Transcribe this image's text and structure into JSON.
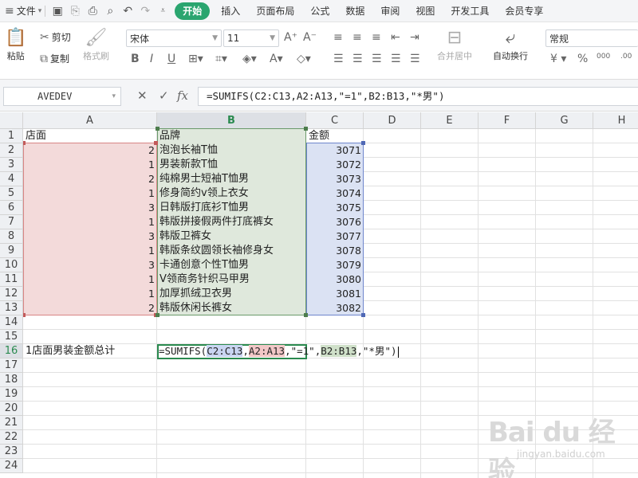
{
  "menubar": {
    "file_label": "文件",
    "tabs": [
      {
        "label": "开始",
        "active": true
      },
      {
        "label": "插入"
      },
      {
        "label": "页面布局"
      },
      {
        "label": "公式"
      },
      {
        "label": "数据"
      },
      {
        "label": "审阅"
      },
      {
        "label": "视图"
      },
      {
        "label": "开发工具"
      },
      {
        "label": "会员专享"
      }
    ]
  },
  "ribbon": {
    "paste_label": "粘贴",
    "cut_label": "剪切",
    "copy_label": "复制",
    "format_painter_label": "格式刷",
    "font_name": "宋体",
    "font_size": "11",
    "merge_center_label": "合并居中",
    "auto_wrap_label": "自动换行",
    "number_format": "常规",
    "currency_symbol": "¥",
    "percent_symbol": "%",
    "thousands_label": "000"
  },
  "formula_bar": {
    "name_box": "AVEDEV",
    "fx_label": "fx",
    "formula": "=SUMIFS(C2:C13,A2:A13,\"=1\",B2:B13,\"*男\")"
  },
  "grid": {
    "columns": [
      "A",
      "B",
      "C",
      "D",
      "E",
      "F",
      "G",
      "H"
    ],
    "rows": [
      "1",
      "2",
      "3",
      "4",
      "5",
      "6",
      "7",
      "8",
      "9",
      "10",
      "11",
      "12",
      "13",
      "14",
      "15",
      "16",
      "17",
      "18",
      "19",
      "20",
      "21",
      "22",
      "23",
      "24"
    ],
    "header_row": {
      "a": "店面",
      "b": "品牌",
      "c": "金额"
    },
    "data_rows": [
      {
        "a": "2",
        "b": "泡泡长袖T恤",
        "c": "3071"
      },
      {
        "a": "1",
        "b": "男装新款T恤",
        "c": "3072"
      },
      {
        "a": "2",
        "b": "纯棉男士短袖T恤男",
        "c": "3073"
      },
      {
        "a": "1",
        "b": "修身简约v领上衣女",
        "c": "3074"
      },
      {
        "a": "3",
        "b": "日韩版打底衫T恤男",
        "c": "3075"
      },
      {
        "a": "1",
        "b": "韩版拼接假两件打底裤女",
        "c": "3076"
      },
      {
        "a": "3",
        "b": "韩版卫裤女",
        "c": "3077"
      },
      {
        "a": "1",
        "b": "韩版条纹圆领长袖修身女",
        "c": "3078"
      },
      {
        "a": "3",
        "b": "卡通创意个性T恤男",
        "c": "3079"
      },
      {
        "a": "1",
        "b": "V领商务针织马甲男",
        "c": "3080"
      },
      {
        "a": "1",
        "b": "加厚抓绒卫衣男",
        "c": "3081"
      },
      {
        "a": "2",
        "b": "韩版休闲长裤女",
        "c": "3082"
      }
    ],
    "row16_label": "1店面男装金额总计",
    "edit": {
      "prefix": "=SUMIFS(",
      "ref1": "C2:C13",
      "sep1": ",",
      "ref2": "A2:A13",
      "mid": ",\"=1\",",
      "ref3": "B2:B13",
      "suffix": ",\"*男\")"
    }
  },
  "watermark": {
    "main": "Bai du 经验",
    "sub": "jingyan.baidu.com"
  },
  "colors": {
    "accent": "#2aa56f",
    "range_a": "#f3dada",
    "range_b": "#dfe8dc",
    "range_c": "#dbe2f3"
  }
}
